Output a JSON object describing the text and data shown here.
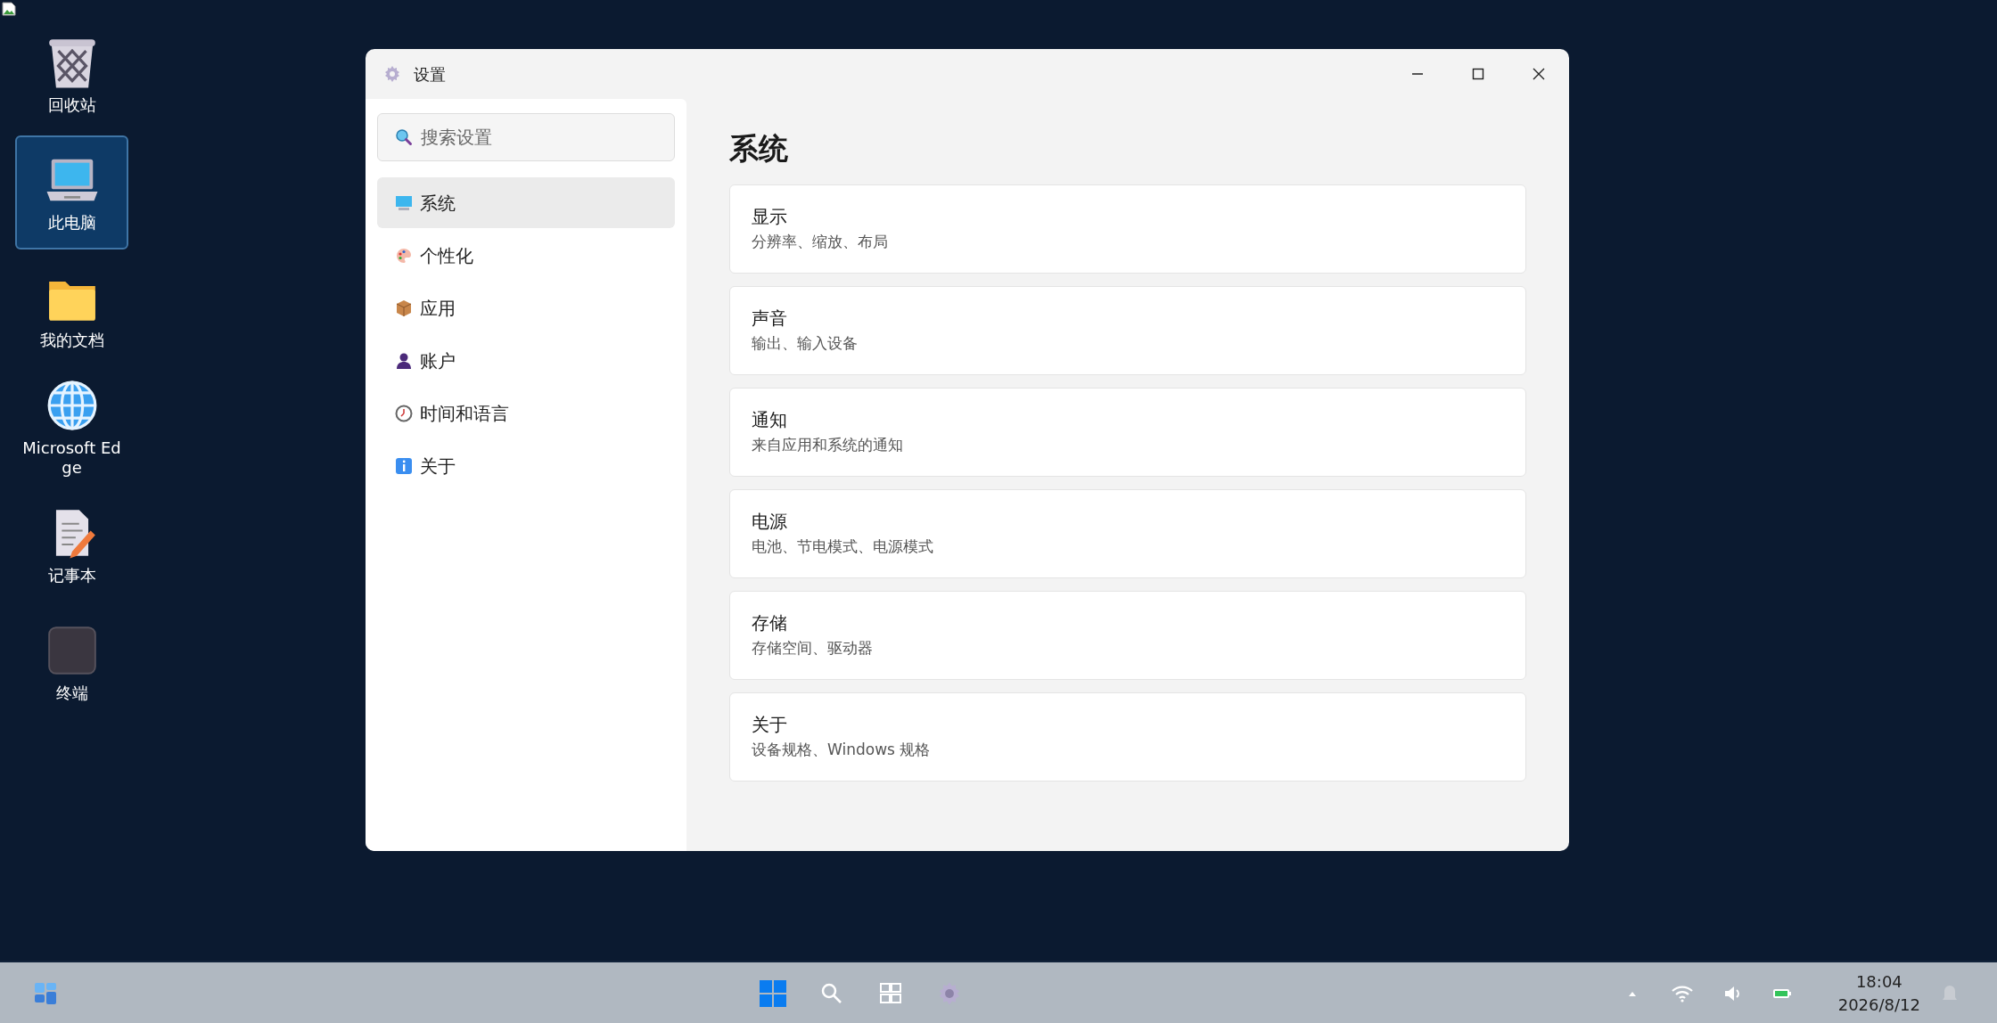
{
  "desktop_icons": [
    {
      "label": "回收站",
      "kind": "trash",
      "selected": false
    },
    {
      "label": "此电脑",
      "kind": "laptop",
      "selected": true
    },
    {
      "label": "我的文档",
      "kind": "folder",
      "selected": false
    },
    {
      "label": "Microsoft Edge",
      "kind": "globe",
      "selected": false
    },
    {
      "label": "记事本",
      "kind": "notepad",
      "selected": false
    },
    {
      "label": "终端",
      "kind": "terminal",
      "selected": false
    }
  ],
  "window": {
    "title": "设置",
    "search": {
      "placeholder": "搜索设置"
    },
    "nav": [
      {
        "label": "系统",
        "kind": "system",
        "selected": true
      },
      {
        "label": "个性化",
        "kind": "palette",
        "selected": false
      },
      {
        "label": "应用",
        "kind": "box",
        "selected": false
      },
      {
        "label": "账户",
        "kind": "user",
        "selected": false
      },
      {
        "label": "时间和语言",
        "kind": "clock",
        "selected": false
      },
      {
        "label": "关于",
        "kind": "info",
        "selected": false
      }
    ],
    "heading": "系统",
    "cards": [
      {
        "title": "显示",
        "subtitle": "分辨率、缩放、布局"
      },
      {
        "title": "声音",
        "subtitle": "输出、输入设备"
      },
      {
        "title": "通知",
        "subtitle": "来自应用和系统的通知"
      },
      {
        "title": "电源",
        "subtitle": "电池、节电模式、电源模式"
      },
      {
        "title": "存储",
        "subtitle": "存储空间、驱动器"
      },
      {
        "title": "关于",
        "subtitle": "设备规格、Windows 规格"
      }
    ]
  },
  "taskbar": {
    "clock": {
      "time": "18:04",
      "date": "2026/8/12"
    }
  }
}
